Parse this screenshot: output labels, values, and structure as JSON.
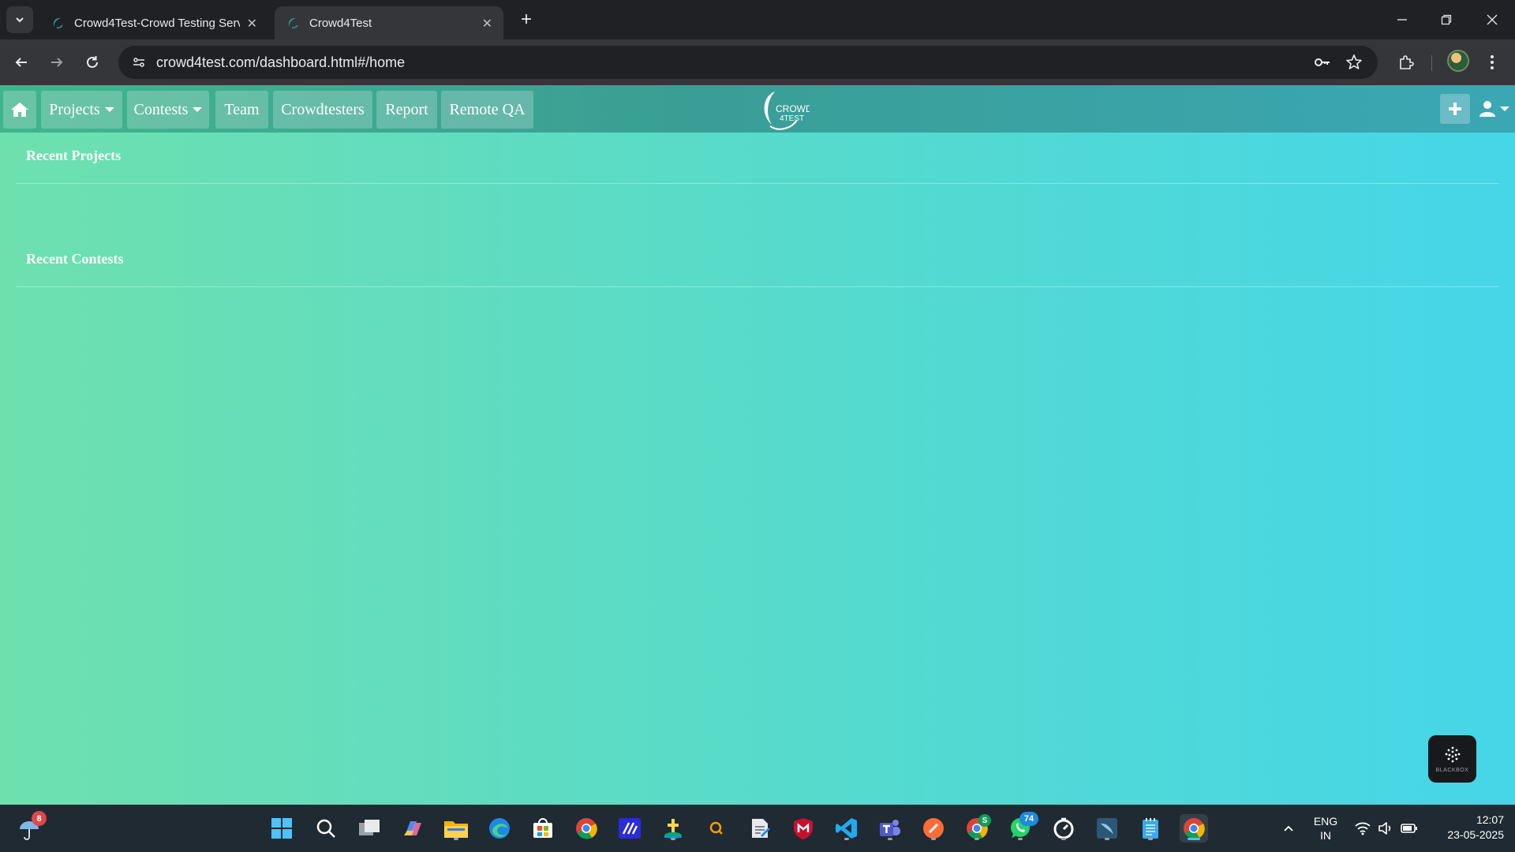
{
  "browser": {
    "tabs": [
      {
        "title": "Crowd4Test-Crowd Testing Serv",
        "active": false
      },
      {
        "title": "Crowd4Test",
        "active": true
      }
    ],
    "url": "crowd4test.com/dashboard.html#/home"
  },
  "navbar": {
    "items": [
      {
        "label": "Projects",
        "dropdown": true
      },
      {
        "label": "Contests",
        "dropdown": true
      },
      {
        "label": "Team",
        "dropdown": false
      },
      {
        "label": "Crowdtesters",
        "dropdown": false
      },
      {
        "label": "Report",
        "dropdown": false
      },
      {
        "label": "Remote QA",
        "dropdown": false
      }
    ],
    "logo_text_1": "CROWD",
    "logo_text_2": "4TEST"
  },
  "main": {
    "recent_projects_title": "Recent Projects",
    "recent_contests_title": "Recent Contests"
  },
  "widget": {
    "label": "BLACKBOX"
  },
  "taskbar": {
    "weather_badge": "8",
    "whatsapp_badge": "74",
    "chrome_profile_badge": "S",
    "language": "ENG",
    "region": "IN",
    "time": "12:07",
    "date": "23-05-2025"
  },
  "colors": {
    "page_gradient_start": "#6ee0ae",
    "page_gradient_end": "#45d6e8",
    "navbar": "#3a9e95",
    "taskbar": "#1f2a33"
  }
}
